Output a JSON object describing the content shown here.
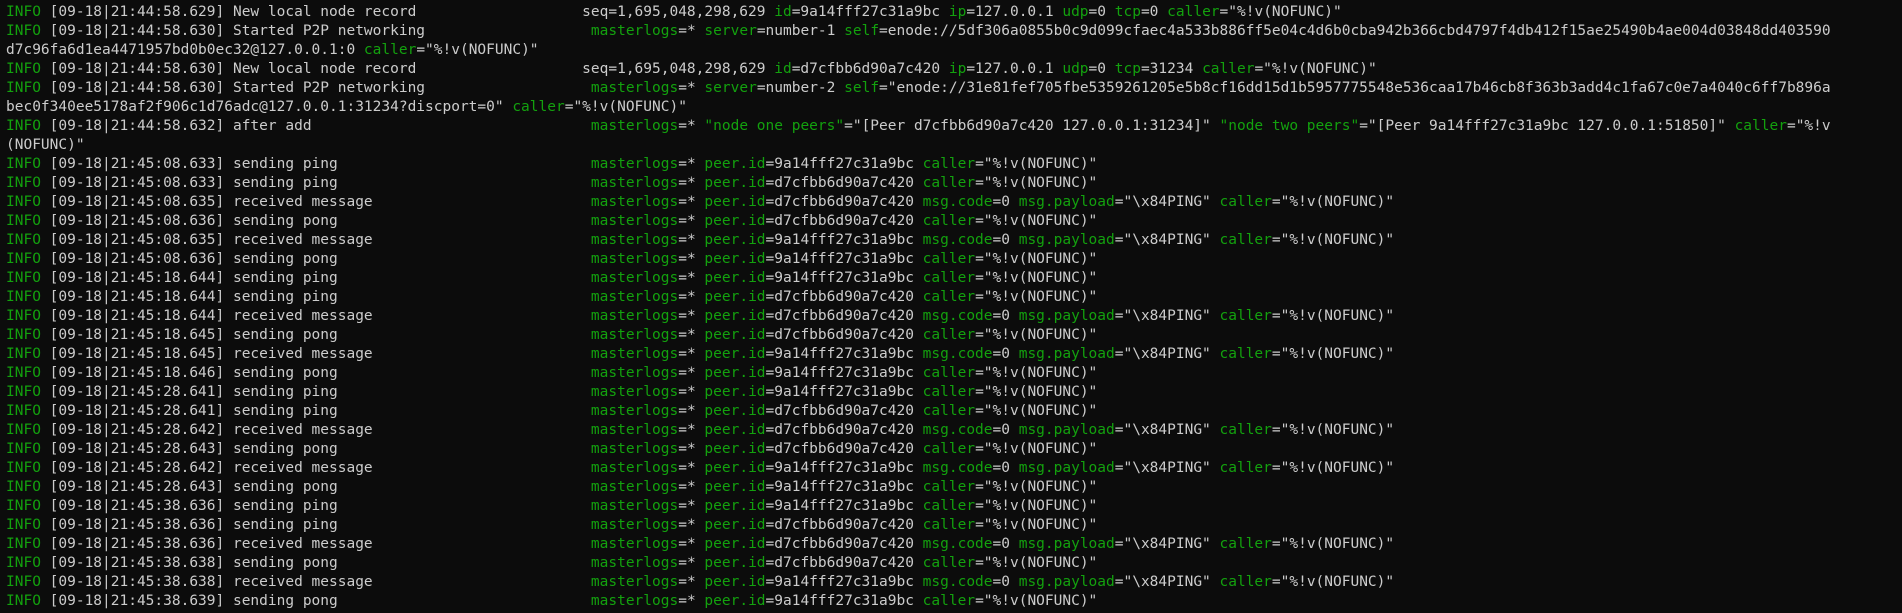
{
  "colors": {
    "background": "#0c0c0c",
    "text": "#cccccc",
    "key": "#13a10e"
  },
  "lines": [
    [
      [
        "g",
        "INFO"
      ],
      [
        "w",
        " [09-18|21:44:58.629] New local node record                   "
      ],
      [
        "w",
        "seq=1,695,048,298,629 "
      ],
      [
        "g",
        "id"
      ],
      [
        "w",
        "=9a14fff27c31a9bc "
      ],
      [
        "g",
        "ip"
      ],
      [
        "w",
        "=127.0.0.1 "
      ],
      [
        "g",
        "udp"
      ],
      [
        "w",
        "=0 "
      ],
      [
        "g",
        "tcp"
      ],
      [
        "w",
        "=0 "
      ],
      [
        "g",
        "caller"
      ],
      [
        "w",
        "=\"%!v(NOFUNC)\""
      ]
    ],
    [
      [
        "g",
        "INFO"
      ],
      [
        "w",
        " [09-18|21:44:58.630] Started P2P networking                   "
      ],
      [
        "g",
        "masterlogs"
      ],
      [
        "w",
        "=* "
      ],
      [
        "g",
        "server"
      ],
      [
        "w",
        "=number-1 "
      ],
      [
        "g",
        "self"
      ],
      [
        "w",
        "=enode://5df306a0855b0c9d099cfaec4a533b886ff5e04c4d6b0cba942b366cbd4797f4db412f15ae25490b4ae004d03848dd403590"
      ]
    ],
    [
      [
        "w",
        "d7c96fa6d1ea4471957bd0b0ec32@127.0.0.1:0 "
      ],
      [
        "g",
        "caller"
      ],
      [
        "w",
        "=\"%!v(NOFUNC)\""
      ]
    ],
    [
      [
        "g",
        "INFO"
      ],
      [
        "w",
        " [09-18|21:44:58.630] New local node record                   "
      ],
      [
        "w",
        "seq=1,695,048,298,629 "
      ],
      [
        "g",
        "id"
      ],
      [
        "w",
        "=d7cfbb6d90a7c420 "
      ],
      [
        "g",
        "ip"
      ],
      [
        "w",
        "=127.0.0.1 "
      ],
      [
        "g",
        "udp"
      ],
      [
        "w",
        "=0 "
      ],
      [
        "g",
        "tcp"
      ],
      [
        "w",
        "=31234 "
      ],
      [
        "g",
        "caller"
      ],
      [
        "w",
        "=\"%!v(NOFUNC)\""
      ]
    ],
    [
      [
        "g",
        "INFO"
      ],
      [
        "w",
        " [09-18|21:44:58.630] Started P2P networking                   "
      ],
      [
        "g",
        "masterlogs"
      ],
      [
        "w",
        "=* "
      ],
      [
        "g",
        "server"
      ],
      [
        "w",
        "=number-2 "
      ],
      [
        "g",
        "self"
      ],
      [
        "w",
        "=\"enode://31e81fef705fbe5359261205e5b8cf16dd15d1b5957775548e536caa17b46cb8f363b3add4c1fa67c0e7a4040c6ff7b896a"
      ]
    ],
    [
      [
        "w",
        "bec0f340ee5178af2f906c1d76adc@127.0.0.1:31234?discport=0\" "
      ],
      [
        "g",
        "caller"
      ],
      [
        "w",
        "=\"%!v(NOFUNC)\""
      ]
    ],
    [
      [
        "g",
        "INFO"
      ],
      [
        "w",
        " [09-18|21:44:58.632] after add                                "
      ],
      [
        "g",
        "masterlogs"
      ],
      [
        "w",
        "=* "
      ],
      [
        "g",
        "\"node one peers\""
      ],
      [
        "w",
        "=\"[Peer d7cfbb6d90a7c420 127.0.0.1:31234]\" "
      ],
      [
        "g",
        "\"node two peers\""
      ],
      [
        "w",
        "=\"[Peer 9a14fff27c31a9bc 127.0.0.1:51850]\" "
      ],
      [
        "g",
        "caller"
      ],
      [
        "w",
        "=\"%!v"
      ]
    ],
    [
      [
        "w",
        "(NOFUNC)\""
      ]
    ],
    [
      [
        "g",
        "INFO"
      ],
      [
        "w",
        " [09-18|21:45:08.633] sending ping                             "
      ],
      [
        "g",
        "masterlogs"
      ],
      [
        "w",
        "=* "
      ],
      [
        "g",
        "peer.id"
      ],
      [
        "w",
        "=9a14fff27c31a9bc "
      ],
      [
        "g",
        "caller"
      ],
      [
        "w",
        "=\"%!v(NOFUNC)\""
      ]
    ],
    [
      [
        "g",
        "INFO"
      ],
      [
        "w",
        " [09-18|21:45:08.633] sending ping                             "
      ],
      [
        "g",
        "masterlogs"
      ],
      [
        "w",
        "=* "
      ],
      [
        "g",
        "peer.id"
      ],
      [
        "w",
        "=d7cfbb6d90a7c420 "
      ],
      [
        "g",
        "caller"
      ],
      [
        "w",
        "=\"%!v(NOFUNC)\""
      ]
    ],
    [
      [
        "g",
        "INFO"
      ],
      [
        "w",
        " [09-18|21:45:08.635] received message                         "
      ],
      [
        "g",
        "masterlogs"
      ],
      [
        "w",
        "=* "
      ],
      [
        "g",
        "peer.id"
      ],
      [
        "w",
        "=d7cfbb6d90a7c420 "
      ],
      [
        "g",
        "msg.code"
      ],
      [
        "w",
        "=0 "
      ],
      [
        "g",
        "msg.payload"
      ],
      [
        "w",
        "=\"\\x84PING\" "
      ],
      [
        "g",
        "caller"
      ],
      [
        "w",
        "=\"%!v(NOFUNC)\""
      ]
    ],
    [
      [
        "g",
        "INFO"
      ],
      [
        "w",
        " [09-18|21:45:08.636] sending pong                             "
      ],
      [
        "g",
        "masterlogs"
      ],
      [
        "w",
        "=* "
      ],
      [
        "g",
        "peer.id"
      ],
      [
        "w",
        "=d7cfbb6d90a7c420 "
      ],
      [
        "g",
        "caller"
      ],
      [
        "w",
        "=\"%!v(NOFUNC)\""
      ]
    ],
    [
      [
        "g",
        "INFO"
      ],
      [
        "w",
        " [09-18|21:45:08.635] received message                         "
      ],
      [
        "g",
        "masterlogs"
      ],
      [
        "w",
        "=* "
      ],
      [
        "g",
        "peer.id"
      ],
      [
        "w",
        "=9a14fff27c31a9bc "
      ],
      [
        "g",
        "msg.code"
      ],
      [
        "w",
        "=0 "
      ],
      [
        "g",
        "msg.payload"
      ],
      [
        "w",
        "=\"\\x84PING\" "
      ],
      [
        "g",
        "caller"
      ],
      [
        "w",
        "=\"%!v(NOFUNC)\""
      ]
    ],
    [
      [
        "g",
        "INFO"
      ],
      [
        "w",
        " [09-18|21:45:08.636] sending pong                             "
      ],
      [
        "g",
        "masterlogs"
      ],
      [
        "w",
        "=* "
      ],
      [
        "g",
        "peer.id"
      ],
      [
        "w",
        "=9a14fff27c31a9bc "
      ],
      [
        "g",
        "caller"
      ],
      [
        "w",
        "=\"%!v(NOFUNC)\""
      ]
    ],
    [
      [
        "g",
        "INFO"
      ],
      [
        "w",
        " [09-18|21:45:18.644] sending ping                             "
      ],
      [
        "g",
        "masterlogs"
      ],
      [
        "w",
        "=* "
      ],
      [
        "g",
        "peer.id"
      ],
      [
        "w",
        "=9a14fff27c31a9bc "
      ],
      [
        "g",
        "caller"
      ],
      [
        "w",
        "=\"%!v(NOFUNC)\""
      ]
    ],
    [
      [
        "g",
        "INFO"
      ],
      [
        "w",
        " [09-18|21:45:18.644] sending ping                             "
      ],
      [
        "g",
        "masterlogs"
      ],
      [
        "w",
        "=* "
      ],
      [
        "g",
        "peer.id"
      ],
      [
        "w",
        "=d7cfbb6d90a7c420 "
      ],
      [
        "g",
        "caller"
      ],
      [
        "w",
        "=\"%!v(NOFUNC)\""
      ]
    ],
    [
      [
        "g",
        "INFO"
      ],
      [
        "w",
        " [09-18|21:45:18.644] received message                         "
      ],
      [
        "g",
        "masterlogs"
      ],
      [
        "w",
        "=* "
      ],
      [
        "g",
        "peer.id"
      ],
      [
        "w",
        "=d7cfbb6d90a7c420 "
      ],
      [
        "g",
        "msg.code"
      ],
      [
        "w",
        "=0 "
      ],
      [
        "g",
        "msg.payload"
      ],
      [
        "w",
        "=\"\\x84PING\" "
      ],
      [
        "g",
        "caller"
      ],
      [
        "w",
        "=\"%!v(NOFUNC)\""
      ]
    ],
    [
      [
        "g",
        "INFO"
      ],
      [
        "w",
        " [09-18|21:45:18.645] sending pong                             "
      ],
      [
        "g",
        "masterlogs"
      ],
      [
        "w",
        "=* "
      ],
      [
        "g",
        "peer.id"
      ],
      [
        "w",
        "=d7cfbb6d90a7c420 "
      ],
      [
        "g",
        "caller"
      ],
      [
        "w",
        "=\"%!v(NOFUNC)\""
      ]
    ],
    [
      [
        "g",
        "INFO"
      ],
      [
        "w",
        " [09-18|21:45:18.645] received message                         "
      ],
      [
        "g",
        "masterlogs"
      ],
      [
        "w",
        "=* "
      ],
      [
        "g",
        "peer.id"
      ],
      [
        "w",
        "=9a14fff27c31a9bc "
      ],
      [
        "g",
        "msg.code"
      ],
      [
        "w",
        "=0 "
      ],
      [
        "g",
        "msg.payload"
      ],
      [
        "w",
        "=\"\\x84PING\" "
      ],
      [
        "g",
        "caller"
      ],
      [
        "w",
        "=\"%!v(NOFUNC)\""
      ]
    ],
    [
      [
        "g",
        "INFO"
      ],
      [
        "w",
        " [09-18|21:45:18.646] sending pong                             "
      ],
      [
        "g",
        "masterlogs"
      ],
      [
        "w",
        "=* "
      ],
      [
        "g",
        "peer.id"
      ],
      [
        "w",
        "=9a14fff27c31a9bc "
      ],
      [
        "g",
        "caller"
      ],
      [
        "w",
        "=\"%!v(NOFUNC)\""
      ]
    ],
    [
      [
        "g",
        "INFO"
      ],
      [
        "w",
        " [09-18|21:45:28.641] sending ping                             "
      ],
      [
        "g",
        "masterlogs"
      ],
      [
        "w",
        "=* "
      ],
      [
        "g",
        "peer.id"
      ],
      [
        "w",
        "=9a14fff27c31a9bc "
      ],
      [
        "g",
        "caller"
      ],
      [
        "w",
        "=\"%!v(NOFUNC)\""
      ]
    ],
    [
      [
        "g",
        "INFO"
      ],
      [
        "w",
        " [09-18|21:45:28.641] sending ping                             "
      ],
      [
        "g",
        "masterlogs"
      ],
      [
        "w",
        "=* "
      ],
      [
        "g",
        "peer.id"
      ],
      [
        "w",
        "=d7cfbb6d90a7c420 "
      ],
      [
        "g",
        "caller"
      ],
      [
        "w",
        "=\"%!v(NOFUNC)\""
      ]
    ],
    [
      [
        "g",
        "INFO"
      ],
      [
        "w",
        " [09-18|21:45:28.642] received message                         "
      ],
      [
        "g",
        "masterlogs"
      ],
      [
        "w",
        "=* "
      ],
      [
        "g",
        "peer.id"
      ],
      [
        "w",
        "=d7cfbb6d90a7c420 "
      ],
      [
        "g",
        "msg.code"
      ],
      [
        "w",
        "=0 "
      ],
      [
        "g",
        "msg.payload"
      ],
      [
        "w",
        "=\"\\x84PING\" "
      ],
      [
        "g",
        "caller"
      ],
      [
        "w",
        "=\"%!v(NOFUNC)\""
      ]
    ],
    [
      [
        "g",
        "INFO"
      ],
      [
        "w",
        " [09-18|21:45:28.643] sending pong                             "
      ],
      [
        "g",
        "masterlogs"
      ],
      [
        "w",
        "=* "
      ],
      [
        "g",
        "peer.id"
      ],
      [
        "w",
        "=d7cfbb6d90a7c420 "
      ],
      [
        "g",
        "caller"
      ],
      [
        "w",
        "=\"%!v(NOFUNC)\""
      ]
    ],
    [
      [
        "g",
        "INFO"
      ],
      [
        "w",
        " [09-18|21:45:28.642] received message                         "
      ],
      [
        "g",
        "masterlogs"
      ],
      [
        "w",
        "=* "
      ],
      [
        "g",
        "peer.id"
      ],
      [
        "w",
        "=9a14fff27c31a9bc "
      ],
      [
        "g",
        "msg.code"
      ],
      [
        "w",
        "=0 "
      ],
      [
        "g",
        "msg.payload"
      ],
      [
        "w",
        "=\"\\x84PING\" "
      ],
      [
        "g",
        "caller"
      ],
      [
        "w",
        "=\"%!v(NOFUNC)\""
      ]
    ],
    [
      [
        "g",
        "INFO"
      ],
      [
        "w",
        " [09-18|21:45:28.643] sending pong                             "
      ],
      [
        "g",
        "masterlogs"
      ],
      [
        "w",
        "=* "
      ],
      [
        "g",
        "peer.id"
      ],
      [
        "w",
        "=9a14fff27c31a9bc "
      ],
      [
        "g",
        "caller"
      ],
      [
        "w",
        "=\"%!v(NOFUNC)\""
      ]
    ],
    [
      [
        "g",
        "INFO"
      ],
      [
        "w",
        " [09-18|21:45:38.636] sending ping                             "
      ],
      [
        "g",
        "masterlogs"
      ],
      [
        "w",
        "=* "
      ],
      [
        "g",
        "peer.id"
      ],
      [
        "w",
        "=9a14fff27c31a9bc "
      ],
      [
        "g",
        "caller"
      ],
      [
        "w",
        "=\"%!v(NOFUNC)\""
      ]
    ],
    [
      [
        "g",
        "INFO"
      ],
      [
        "w",
        " [09-18|21:45:38.636] sending ping                             "
      ],
      [
        "g",
        "masterlogs"
      ],
      [
        "w",
        "=* "
      ],
      [
        "g",
        "peer.id"
      ],
      [
        "w",
        "=d7cfbb6d90a7c420 "
      ],
      [
        "g",
        "caller"
      ],
      [
        "w",
        "=\"%!v(NOFUNC)\""
      ]
    ],
    [
      [
        "g",
        "INFO"
      ],
      [
        "w",
        " [09-18|21:45:38.636] received message                         "
      ],
      [
        "g",
        "masterlogs"
      ],
      [
        "w",
        "=* "
      ],
      [
        "g",
        "peer.id"
      ],
      [
        "w",
        "=d7cfbb6d90a7c420 "
      ],
      [
        "g",
        "msg.code"
      ],
      [
        "w",
        "=0 "
      ],
      [
        "g",
        "msg.payload"
      ],
      [
        "w",
        "=\"\\x84PING\" "
      ],
      [
        "g",
        "caller"
      ],
      [
        "w",
        "=\"%!v(NOFUNC)\""
      ]
    ],
    [
      [
        "g",
        "INFO"
      ],
      [
        "w",
        " [09-18|21:45:38.638] sending pong                             "
      ],
      [
        "g",
        "masterlogs"
      ],
      [
        "w",
        "=* "
      ],
      [
        "g",
        "peer.id"
      ],
      [
        "w",
        "=d7cfbb6d90a7c420 "
      ],
      [
        "g",
        "caller"
      ],
      [
        "w",
        "=\"%!v(NOFUNC)\""
      ]
    ],
    [
      [
        "g",
        "INFO"
      ],
      [
        "w",
        " [09-18|21:45:38.638] received message                         "
      ],
      [
        "g",
        "masterlogs"
      ],
      [
        "w",
        "=* "
      ],
      [
        "g",
        "peer.id"
      ],
      [
        "w",
        "=9a14fff27c31a9bc "
      ],
      [
        "g",
        "msg.code"
      ],
      [
        "w",
        "=0 "
      ],
      [
        "g",
        "msg.payload"
      ],
      [
        "w",
        "=\"\\x84PING\" "
      ],
      [
        "g",
        "caller"
      ],
      [
        "w",
        "=\"%!v(NOFUNC)\""
      ]
    ],
    [
      [
        "g",
        "INFO"
      ],
      [
        "w",
        " [09-18|21:45:38.639] sending pong                             "
      ],
      [
        "g",
        "masterlogs"
      ],
      [
        "w",
        "=* "
      ],
      [
        "g",
        "peer.id"
      ],
      [
        "w",
        "=9a14fff27c31a9bc "
      ],
      [
        "g",
        "caller"
      ],
      [
        "w",
        "=\"%!v(NOFUNC)\""
      ]
    ]
  ]
}
